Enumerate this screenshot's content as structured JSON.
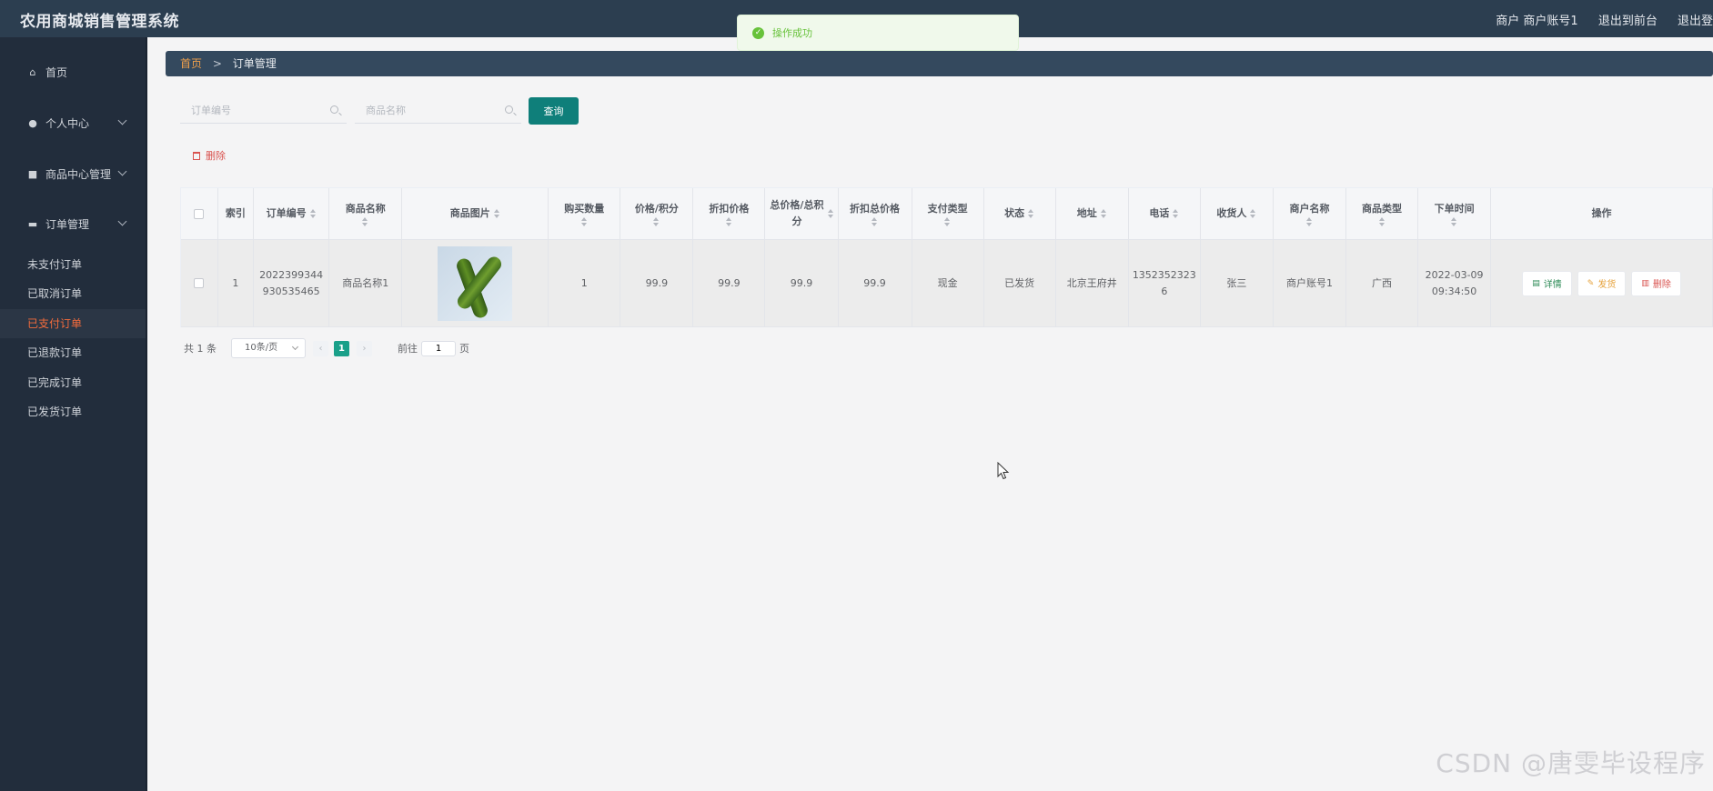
{
  "app": {
    "title": "农用商城销售管理系统"
  },
  "header": {
    "user_label": "商户 商户账号1",
    "back_front_label": "退出到前台",
    "logout_label": "退出登"
  },
  "toast": {
    "message": "操作成功",
    "color": "#67c23a"
  },
  "sidebar": {
    "items": [
      {
        "label": "首页",
        "icon": "home-icon"
      },
      {
        "label": "个人中心",
        "icon": "user-icon"
      },
      {
        "label": "商品中心管理",
        "icon": "goods-icon"
      },
      {
        "label": "订单管理",
        "icon": "monitor-icon"
      }
    ],
    "order_sub": [
      {
        "label": "未支付订单"
      },
      {
        "label": "已取消订单"
      },
      {
        "label": "已支付订单",
        "active": true
      },
      {
        "label": "已退款订单"
      },
      {
        "label": "已完成订单"
      },
      {
        "label": "已发货订单"
      }
    ]
  },
  "breadcrumb": {
    "home": "首页",
    "separator": ">",
    "current": "订单管理"
  },
  "search": {
    "order_no_placeholder": "订单编号",
    "goods_name_placeholder": "商品名称",
    "query_label": "查询"
  },
  "toolbar": {
    "delete_label": "删除"
  },
  "table": {
    "headers": {
      "index": "索引",
      "order_no": "订单编号",
      "goods_name": "商品名称",
      "goods_image": "商品图片",
      "quantity": "购买数量",
      "price": "价格/积分",
      "discount_price": "折扣价格",
      "total": "总价格/总积分",
      "discount_total": "折扣总价格",
      "pay_type": "支付类型",
      "status": "状态",
      "address": "地址",
      "phone": "电话",
      "receiver": "收货人",
      "merchant": "商户名称",
      "category": "商品类型",
      "order_time": "下单时间",
      "actions": "操作"
    },
    "rows": [
      {
        "index": "1",
        "order_no": "2022399344930535465",
        "goods_name": "商品名称1",
        "quantity": "1",
        "price": "99.9",
        "discount_price": "99.9",
        "total": "99.9",
        "discount_total": "99.9",
        "pay_type": "现金",
        "status": "已发货",
        "address": "北京王府井",
        "phone": "13523523236",
        "receiver": "张三",
        "merchant": "商户账号1",
        "category": "广西",
        "order_time": "2022-03-09 09:34:50",
        "detail_label": "详情",
        "ship_label": "发货",
        "delete_label": "删除"
      }
    ]
  },
  "pagination": {
    "total_label": "共 1 条",
    "page_size": "10条/页",
    "current_page": "1",
    "goto_label": "前往",
    "goto_value": "1",
    "page_unit": "页"
  },
  "watermark": "CSDN @唐雯毕设程序",
  "colors": {
    "topbar": "#2c3e50",
    "sidebar": "#222d3c",
    "accent": "#0f7f7a",
    "active_menu": "#f56c3c",
    "breadcrumb_bg": "#34495e"
  }
}
